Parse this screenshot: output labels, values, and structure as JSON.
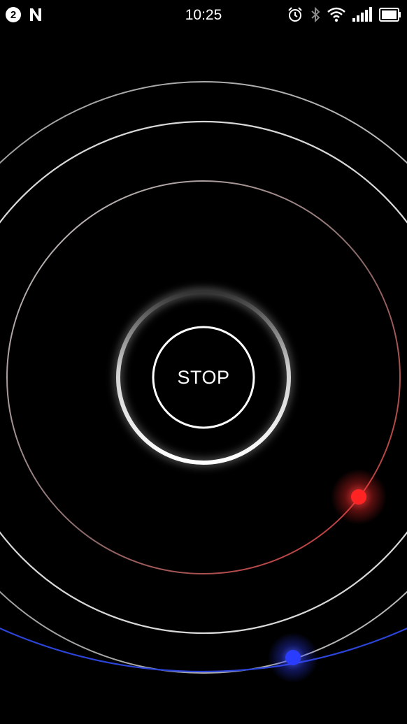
{
  "status_bar": {
    "notification_count": "2",
    "time": "10:25",
    "icons": [
      "notification-count-badge",
      "n-app-icon",
      "alarm-icon",
      "bluetooth-icon",
      "wifi-icon",
      "signal-icon",
      "battery-icon"
    ]
  },
  "main": {
    "stop_label": "STOP"
  },
  "colors": {
    "background": "#000000",
    "orbit_red": "#d63030",
    "orbit_blue": "#2c44d8",
    "orbit_white": "#d8d8d8",
    "dot_red": "#ff2424",
    "dot_blue": "#2a3cff"
  }
}
